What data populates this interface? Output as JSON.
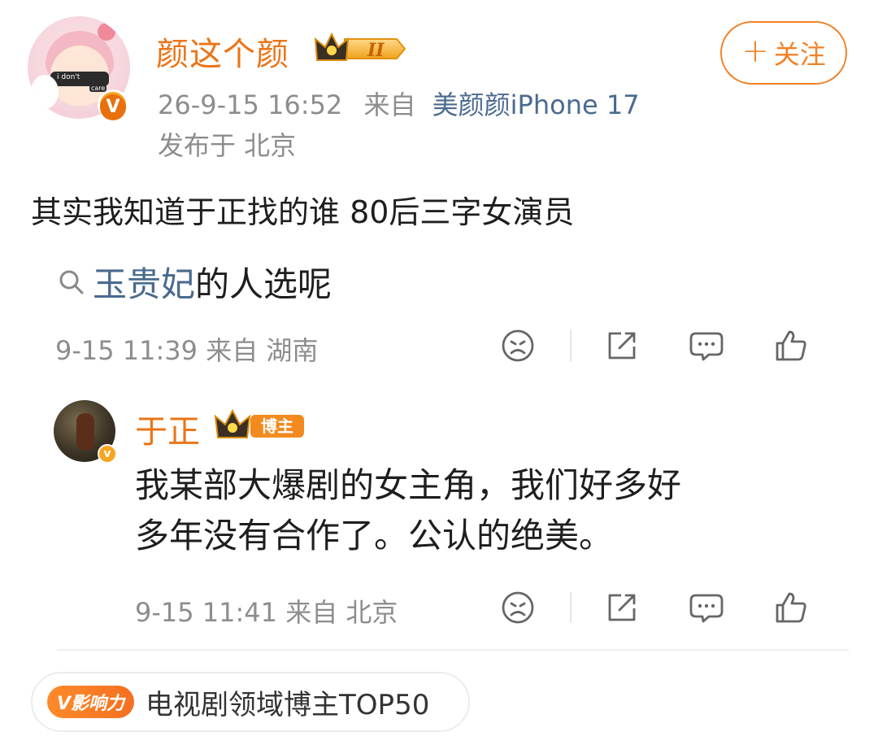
{
  "post": {
    "author": {
      "name": "颜这个颜",
      "level_badge": "II",
      "avatar_text_1": "i don't",
      "avatar_text_2": "care"
    },
    "follow_label": "关注",
    "timestamp": "26-9-15 16:52",
    "source_prefix": "来自",
    "source": "美颜颜iPhone 17",
    "location": "发布于 北京",
    "text": "其实我知道于正找的谁  80后三字女演员"
  },
  "comment": {
    "search_highlight": "玉贵妃",
    "text_rest": "的人选呢",
    "timestamp": "9-15 11:39 来自 湖南"
  },
  "reply": {
    "author": "于正",
    "badge": "博主",
    "text_line1": "我某部大爆剧的女主角，我们好多好",
    "text_line2": "多年没有合作了。公认的绝美。",
    "timestamp": "9-15 11:41 来自 北京"
  },
  "influence": {
    "badge": "V影响力",
    "label": "电视剧领域博主TOP50"
  },
  "colors": {
    "accent_orange": "#eb7417",
    "link_blue": "#4a6a8f",
    "meta_gray": "#8d8d8d"
  },
  "icons": [
    "sad-face-icon",
    "share-icon",
    "comment-icon",
    "like-icon",
    "search-icon"
  ]
}
